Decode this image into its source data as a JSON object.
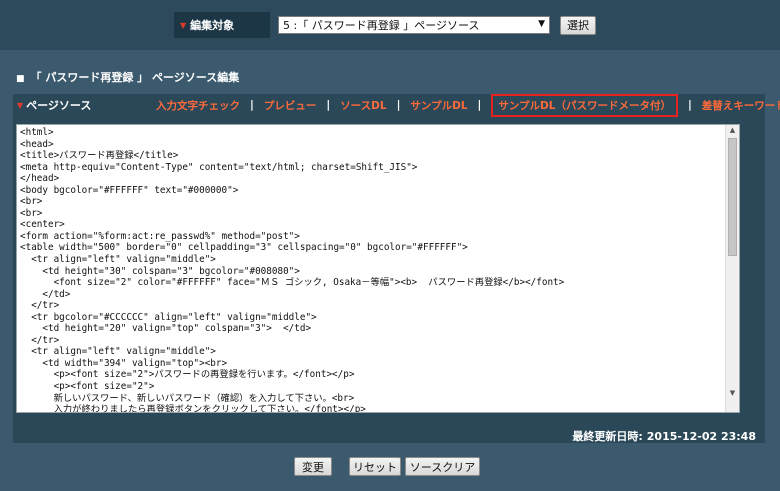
{
  "top": {
    "target_label": "編集対象",
    "target_selected": "5 :「 パスワード再登録 」ページソース",
    "select_button": "選択"
  },
  "section_title": "「 パスワード再登録 」 ページソース編集",
  "panel": {
    "title": "ページソース",
    "links": [
      "入力文字チェック",
      "プレビュー",
      "ソースDL",
      "サンプルDL",
      "サンプルDL（パスワードメータ付）",
      "差替えキーワード表示"
    ]
  },
  "source_code": "<html>\n<head>\n<title>パスワード再登録</title>\n<meta http-equiv=\"Content-Type\" content=\"text/html; charset=Shift_JIS\">\n</head>\n<body bgcolor=\"#FFFFFF\" text=\"#000000\">\n<br>\n<br>\n<center>\n<form action=\"%form:act:re_passwd%\" method=\"post\">\n<table width=\"500\" border=\"0\" cellpadding=\"3\" cellspacing=\"0\" bgcolor=\"#FFFFFF\">\n  <tr align=\"left\" valign=\"middle\">\n    <td height=\"30\" colspan=\"3\" bgcolor=\"#008080\">\n      <font size=\"2\" color=\"#FFFFFF\" face=\"ＭＳ ゴシック, Osaka－等幅\"><b>  パスワード再登録</b></font>\n    </td>\n  </tr>\n  <tr bgcolor=\"#CCCCCC\" align=\"left\" valign=\"middle\">\n    <td height=\"20\" valign=\"top\" colspan=\"3\">  </td>\n  </tr>\n  <tr align=\"left\" valign=\"middle\">\n    <td width=\"394\" valign=\"top\"><br>\n      <p><font size=\"2\">パスワードの再登録を行います。</font></p>\n      <p><font size=\"2\">\n      新しいパスワード、新しいパスワード（確認）を入力して下さい。<br>\n      入力が終わりましたら再登録ボタンをクリックして下さい。</font></p>",
  "footer": {
    "updated_label": "最終更新日時:",
    "updated_value": "2015-12-02 23:48"
  },
  "actions": {
    "change": "変更",
    "reset": "リセット",
    "clear": "ソースクリア"
  },
  "colors": {
    "background": "#3b5a6e",
    "panel": "#2b4858",
    "link": "#ff6a3a",
    "highlight_border": "#e8231f"
  }
}
